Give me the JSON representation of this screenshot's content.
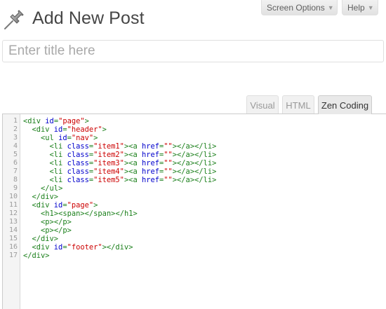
{
  "header": {
    "title": "Add New Post",
    "icon": "pin-icon"
  },
  "screen_options": {
    "label": "Screen Options",
    "arrow": "▼"
  },
  "help": {
    "label": "Help",
    "arrow": "▼"
  },
  "title_field": {
    "placeholder": "Enter title here",
    "value": ""
  },
  "editor_tabs": [
    {
      "label": "Visual",
      "active": false
    },
    {
      "label": "HTML",
      "active": false
    },
    {
      "label": "Zen Coding",
      "active": true
    }
  ],
  "editor": {
    "line_numbers": [
      "1",
      "2",
      "3",
      "4",
      "5",
      "6",
      "7",
      "8",
      "9",
      "10",
      "11",
      "12",
      "13",
      "14",
      "15",
      "16",
      "17"
    ],
    "lines": [
      "<div id=\"page\">",
      "  <div id=\"header\">",
      "    <ul id=\"nav\">",
      "      <li class=\"item1\"><a href=\"\"></a></li>",
      "      <li class=\"item2\"><a href=\"\"></a></li>",
      "      <li class=\"item3\"><a href=\"\"></a></li>",
      "      <li class=\"item4\"><a href=\"\"></a></li>",
      "      <li class=\"item5\"><a href=\"\"></a></li>",
      "    </ul>",
      "  </div>",
      "  <div id=\"page\">",
      "    <h1><span></span></h1>",
      "    <p></p>",
      "    <p></p>",
      "  </div>",
      "  <div id=\"footer\"></div>",
      "</div>"
    ]
  },
  "colors": {
    "tag": "#1a7f1a",
    "attribute": "#0000cc",
    "value": "#cc0000"
  }
}
